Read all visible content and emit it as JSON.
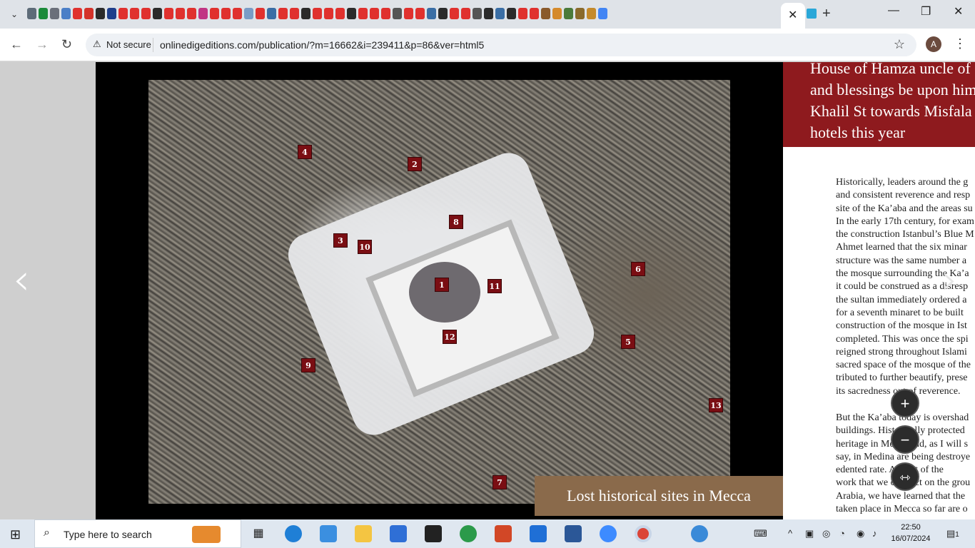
{
  "browser": {
    "tab_title_close": "✕",
    "new_tab": "+",
    "window": {
      "minimize": "—",
      "maximize": "❐",
      "close": "✕"
    },
    "nav": {
      "back": "←",
      "forward": "→",
      "reload": "↻"
    },
    "security_label": "Not secure",
    "security_icon": "⚠",
    "url": "onlinedigeditions.com/publication/?m=16662&i=239411&p=86&ver=html5",
    "star": "☆",
    "avatar_letter": "A",
    "menu": "⋮",
    "tab_menu": "⌄"
  },
  "viewer": {
    "prev_arrow": "‹",
    "next_arrow": "›",
    "map_markers": [
      "4",
      "2",
      "8",
      "3",
      "10",
      "1",
      "11",
      "6",
      "12",
      "5",
      "9",
      "13",
      "7"
    ],
    "caption": "Lost historical sites in Mecca",
    "heading": "House of Hamza uncle of \nand blessings be upon him\nKhalil St towards Misfala\nhotels this year",
    "paragraph1": "Historically, leaders around the g\nand consistent reverence and resp\nsite of the Ka’aba and the areas su\nIn the early 17th century, for exam\nthe construction Istanbul’s Blue M\nAhmet learned that the six minar\nstructure was the same number a\nthe mosque surrounding the Ka’a\nit could be construed as a disresp\nthe sultan immediately ordered a\nfor a seventh minaret to be built \nconstruction of the mosque in Ist\ncompleted. This was once the spi\nreigned strong throughout Islami\nsacred space of the mosque of the\ntributed to further beautify, prese\nits sacredness out of reverence.",
    "paragraph2": "But the Ka’aba today is overshad\nbuildings. Historically protected \nheritage in Mecca and, as I will s\nsay, in Medina are being destroye\nedented rate. As part of the \nwork that we conduct on the grou\nArabia, we have learned that the \ntaken place in Mecca so far are o",
    "zoom_in": "+",
    "zoom_out": "−",
    "fit": "⇿"
  },
  "taskbar": {
    "search_placeholder": "Type here to search",
    "time": "22:50",
    "date": "16/07/2024",
    "notification_count": "1"
  },
  "colors": {
    "accent_red": "#8e1a1e",
    "caption_brown": "#8a6a4b"
  }
}
